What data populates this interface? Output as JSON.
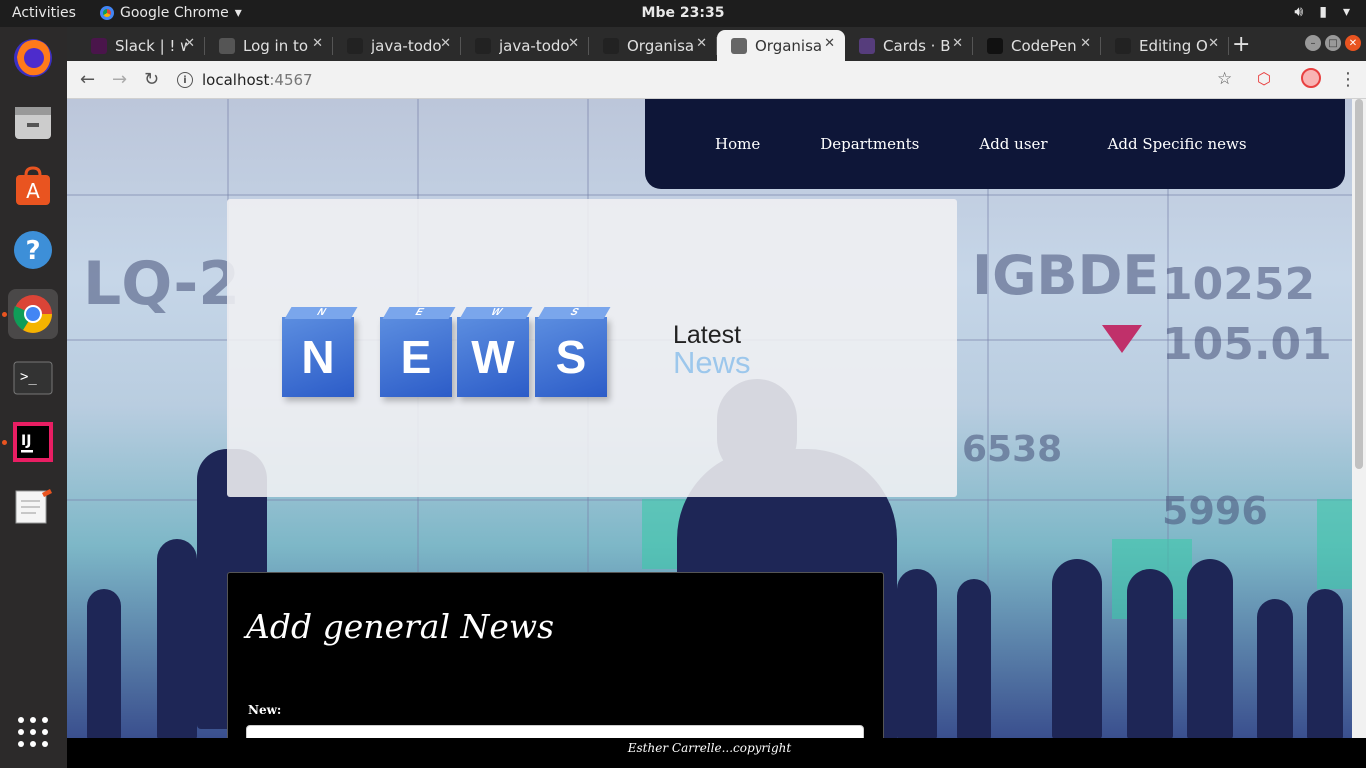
{
  "system": {
    "activities": "Activities",
    "app_name": "Google Chrome",
    "clock": "Mbe 23:35"
  },
  "dock": [
    {
      "name": "firefox-icon"
    },
    {
      "name": "files-icon"
    },
    {
      "name": "software-center-icon"
    },
    {
      "name": "help-icon"
    },
    {
      "name": "chrome-icon"
    },
    {
      "name": "terminal-icon"
    },
    {
      "name": "intellij-icon"
    },
    {
      "name": "text-editor-icon"
    }
  ],
  "tabs": [
    {
      "label": "Slack | ! w",
      "icon": "slack-icon",
      "color": "#4a154b"
    },
    {
      "label": "Log in to",
      "icon": "github-icon",
      "color": "#555555"
    },
    {
      "label": "java-todo",
      "icon": "github-icon",
      "color": "#222222"
    },
    {
      "label": "java-todo",
      "icon": "github-icon",
      "color": "#222222"
    },
    {
      "label": "Organisa",
      "icon": "github-icon",
      "color": "#222222"
    },
    {
      "label": "Organisa",
      "icon": "globe-icon",
      "color": "#666666",
      "active": true
    },
    {
      "label": "Cards · B",
      "icon": "bootstrap-icon",
      "color": "#563d7c"
    },
    {
      "label": "CodePen",
      "icon": "codepen-icon",
      "color": "#111111"
    },
    {
      "label": "Editing O",
      "icon": "github-icon",
      "color": "#222222"
    }
  ],
  "address_bar": {
    "host": "localhost",
    "port": ":4567"
  },
  "page": {
    "nav": [
      "Home",
      "Departments",
      "Add user",
      "Add Specific news"
    ],
    "banner": {
      "cube_letters": [
        "N",
        "E",
        "W",
        "S"
      ],
      "latest": "Latest",
      "news": "News"
    },
    "form": {
      "title": "Add general News",
      "label": "New:",
      "input_value": ""
    },
    "footer": "Esther Carrelle...copyright"
  },
  "colors": {
    "nav_bg": "#0e1638",
    "accent_blue": "#9cc7ec",
    "cube_blue": "#3a6fd8"
  }
}
